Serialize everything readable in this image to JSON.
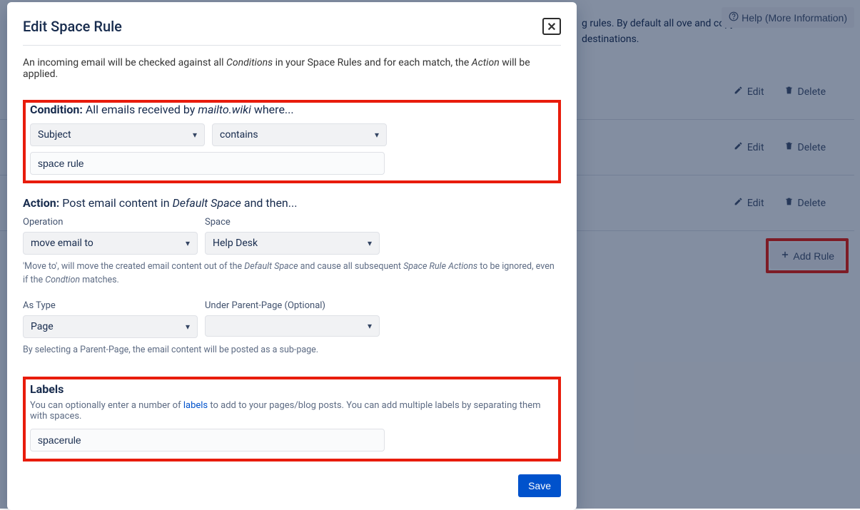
{
  "backdrop": {
    "top_text": "g rules. By default all ove and copy content to other destinations.",
    "help_label": "Help (More Information)",
    "rules": [
      {
        "edit": "Edit",
        "delete": "Delete"
      },
      {
        "edit": "Edit",
        "delete": "Delete"
      },
      {
        "edit": "Edit",
        "delete": "Delete"
      }
    ],
    "add_rule_label": "Add Rule"
  },
  "modal": {
    "title": "Edit Space Rule",
    "intro_prefix": "An incoming email will be checked against all ",
    "intro_em1": "Conditions",
    "intro_mid": " in your Space Rules and for each match, the ",
    "intro_em2": "Action",
    "intro_suffix": " will be applied.",
    "condition": {
      "heading": "Condition:",
      "text_prefix": " All emails received by ",
      "text_em": "mailto.wiki",
      "text_suffix": " where...",
      "field_value": "Subject",
      "operator_value": "contains",
      "input_value": "space rule"
    },
    "action": {
      "heading": "Action:",
      "text_prefix": " Post email content in ",
      "text_em": "Default Space",
      "text_suffix": " and then...",
      "operation_label": "Operation",
      "operation_value": "move email to",
      "space_label": "Space",
      "space_value": "Help Desk",
      "hint_prefix": "'Move to', will move the created email content out of the ",
      "hint_em1": "Default Space",
      "hint_mid": " and cause all subsequent ",
      "hint_em2": "Space Rule Actions",
      "hint_mid2": " to be ignored, even if the ",
      "hint_em3": "Condtion",
      "hint_suffix": " matches.",
      "as_type_label": "As Type",
      "as_type_value": "Page",
      "parent_label": "Under Parent-Page (Optional)",
      "parent_value": "",
      "type_hint": "By selecting a Parent-Page, the email content will be posted as a sub-page."
    },
    "labels": {
      "heading": "Labels",
      "hint_prefix": "You can optionally enter a number of ",
      "hint_link": "labels",
      "hint_suffix": " to add to your pages/blog posts. You can add multiple labels by separating them with spaces.",
      "input_value": "spacerule"
    },
    "save_label": "Save"
  }
}
